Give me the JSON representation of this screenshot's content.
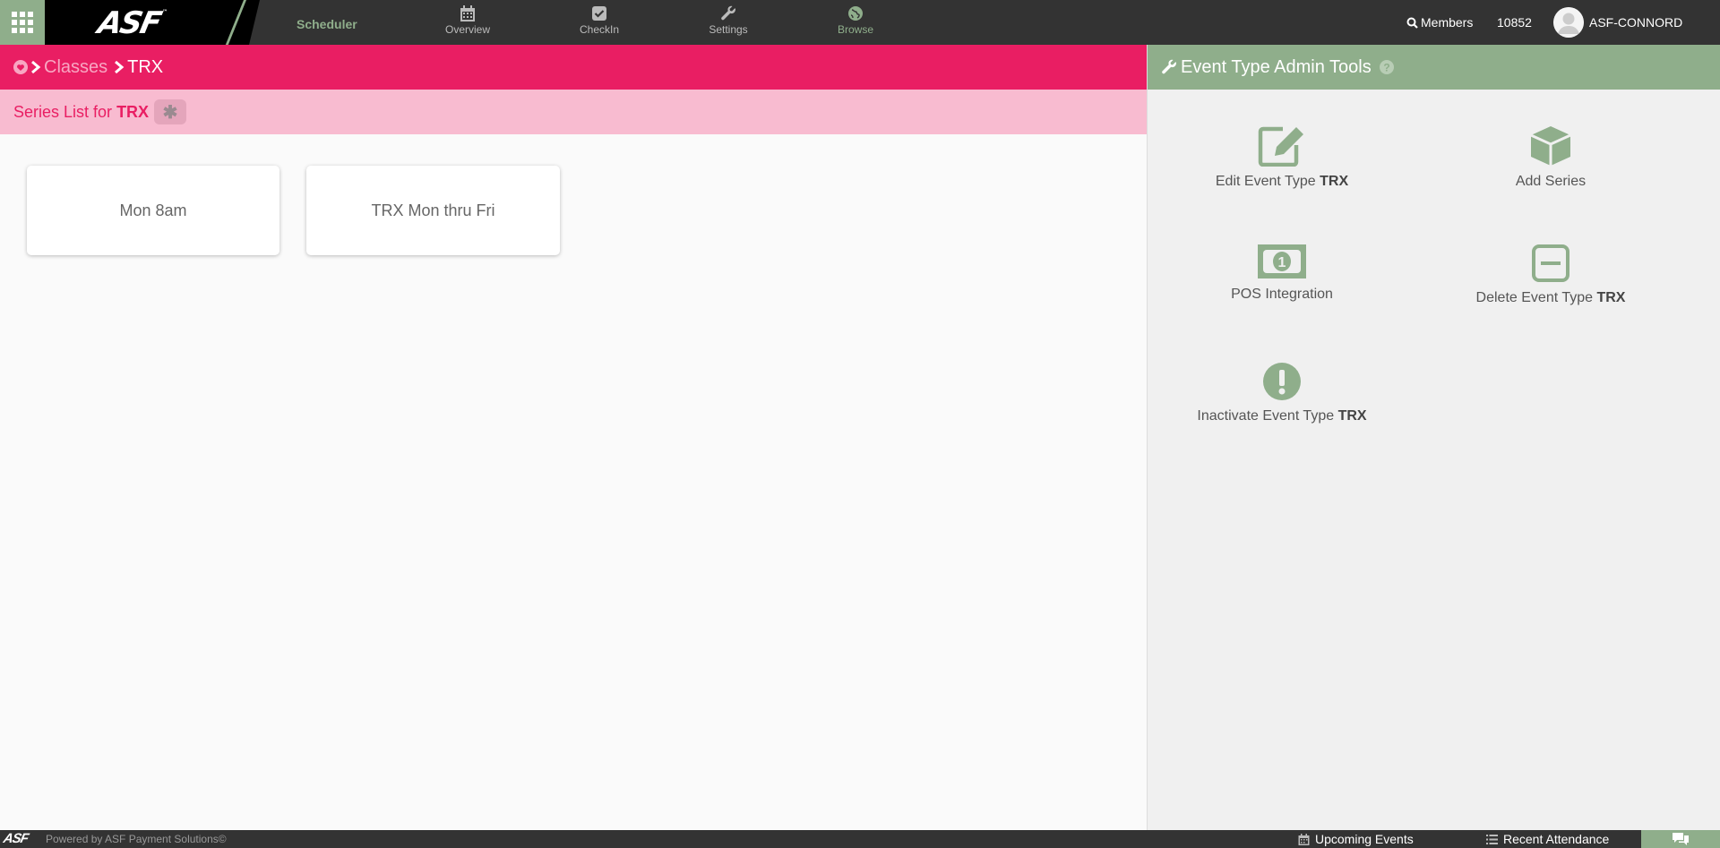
{
  "topbar": {
    "logo": "ASF",
    "logo_mark": "™",
    "app_title": "Scheduler",
    "nav": [
      {
        "label": "Overview",
        "icon": "calendar-icon"
      },
      {
        "label": "CheckIn",
        "icon": "checkbox-icon"
      },
      {
        "label": "Settings",
        "icon": "wrench-icon"
      },
      {
        "label": "Browse",
        "icon": "globe-icon"
      }
    ],
    "members_label": "Members",
    "count": "10852",
    "user_name": "ASF-CONNORD"
  },
  "breadcrumb": {
    "parent": "Classes",
    "current": "TRX"
  },
  "series": {
    "prefix": "Series List for",
    "event_type": "TRX",
    "star": "✱",
    "cards": [
      "Mon 8am",
      "TRX Mon thru Fri"
    ]
  },
  "admin": {
    "title": "Event Type Admin Tools",
    "tools": [
      {
        "label": "Edit Event Type",
        "bold": "TRX",
        "icon": "edit-icon"
      },
      {
        "label": "Add Series",
        "bold": "",
        "icon": "cube-icon"
      },
      {
        "label": "POS Integration",
        "bold": "",
        "icon": "money-icon"
      },
      {
        "label": "Delete Event Type",
        "bold": "TRX",
        "icon": "minus-square-icon"
      },
      {
        "label": "Inactivate Event Type",
        "bold": "TRX",
        "icon": "exclamation-circle-icon"
      }
    ]
  },
  "footer": {
    "logo": "ASF",
    "powered": "Powered by ASF Payment Solutions©",
    "upcoming": "Upcoming Events",
    "recent": "Recent Attendance"
  },
  "colors": {
    "pink": "#e91e63",
    "light_pink": "#f8bbd0",
    "sage": "#8fae8b",
    "dark": "#333333"
  }
}
